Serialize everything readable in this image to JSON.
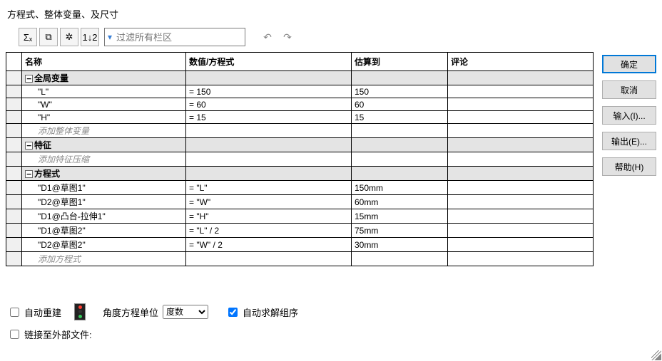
{
  "title": "方程式、整体变量、及尺寸",
  "toolbar": {
    "btn_sigma": "Σₓ",
    "btn_eye_rect": "⧉",
    "btn_eye_gear": "✲",
    "btn_order": "1↓2",
    "filter_placeholder": "过滤所有栏区",
    "btn_undo": "↶",
    "btn_redo": "↷"
  },
  "headers": {
    "name": "名称",
    "value": "数值/方程式",
    "eval": "估算到",
    "comment": "评论"
  },
  "sections": {
    "globals": {
      "label": "全局变量",
      "rows": [
        {
          "name": "\"L\"",
          "value": "= 150",
          "eval": "150"
        },
        {
          "name": "\"W\"",
          "value": "= 60",
          "eval": "60"
        },
        {
          "name": "\"H\"",
          "value": "= 15",
          "eval": "15"
        }
      ],
      "placeholder": "添加整体变量"
    },
    "features": {
      "label": "特征",
      "placeholder": "添加特征压缩"
    },
    "equations": {
      "label": "方程式",
      "rows": [
        {
          "name": "\"D1@草图1\"",
          "value": "= \"L\"",
          "eval": "150mm"
        },
        {
          "name": "\"D2@草图1\"",
          "value": "= \"W\"",
          "eval": "60mm"
        },
        {
          "name": "\"D1@凸台-拉伸1\"",
          "value": "= \"H\"",
          "eval": "15mm"
        },
        {
          "name": "\"D1@草图2\"",
          "value": "= \"L\" / 2",
          "eval": "75mm"
        },
        {
          "name": "\"D2@草图2\"",
          "value": "= \"W\" / 2",
          "eval": "30mm"
        }
      ],
      "placeholder": "添加方程式"
    }
  },
  "buttons": {
    "ok": "确定",
    "cancel": "取消",
    "import": "输入(I)...",
    "export": "输出(E)...",
    "help": "帮助(H)"
  },
  "bottom": {
    "auto_rebuild": "自动重建",
    "angle_unit_label": "角度方程单位",
    "angle_unit_value": "度数",
    "auto_solve": "自动求解组序",
    "link_file": "链接至外部文件:"
  }
}
